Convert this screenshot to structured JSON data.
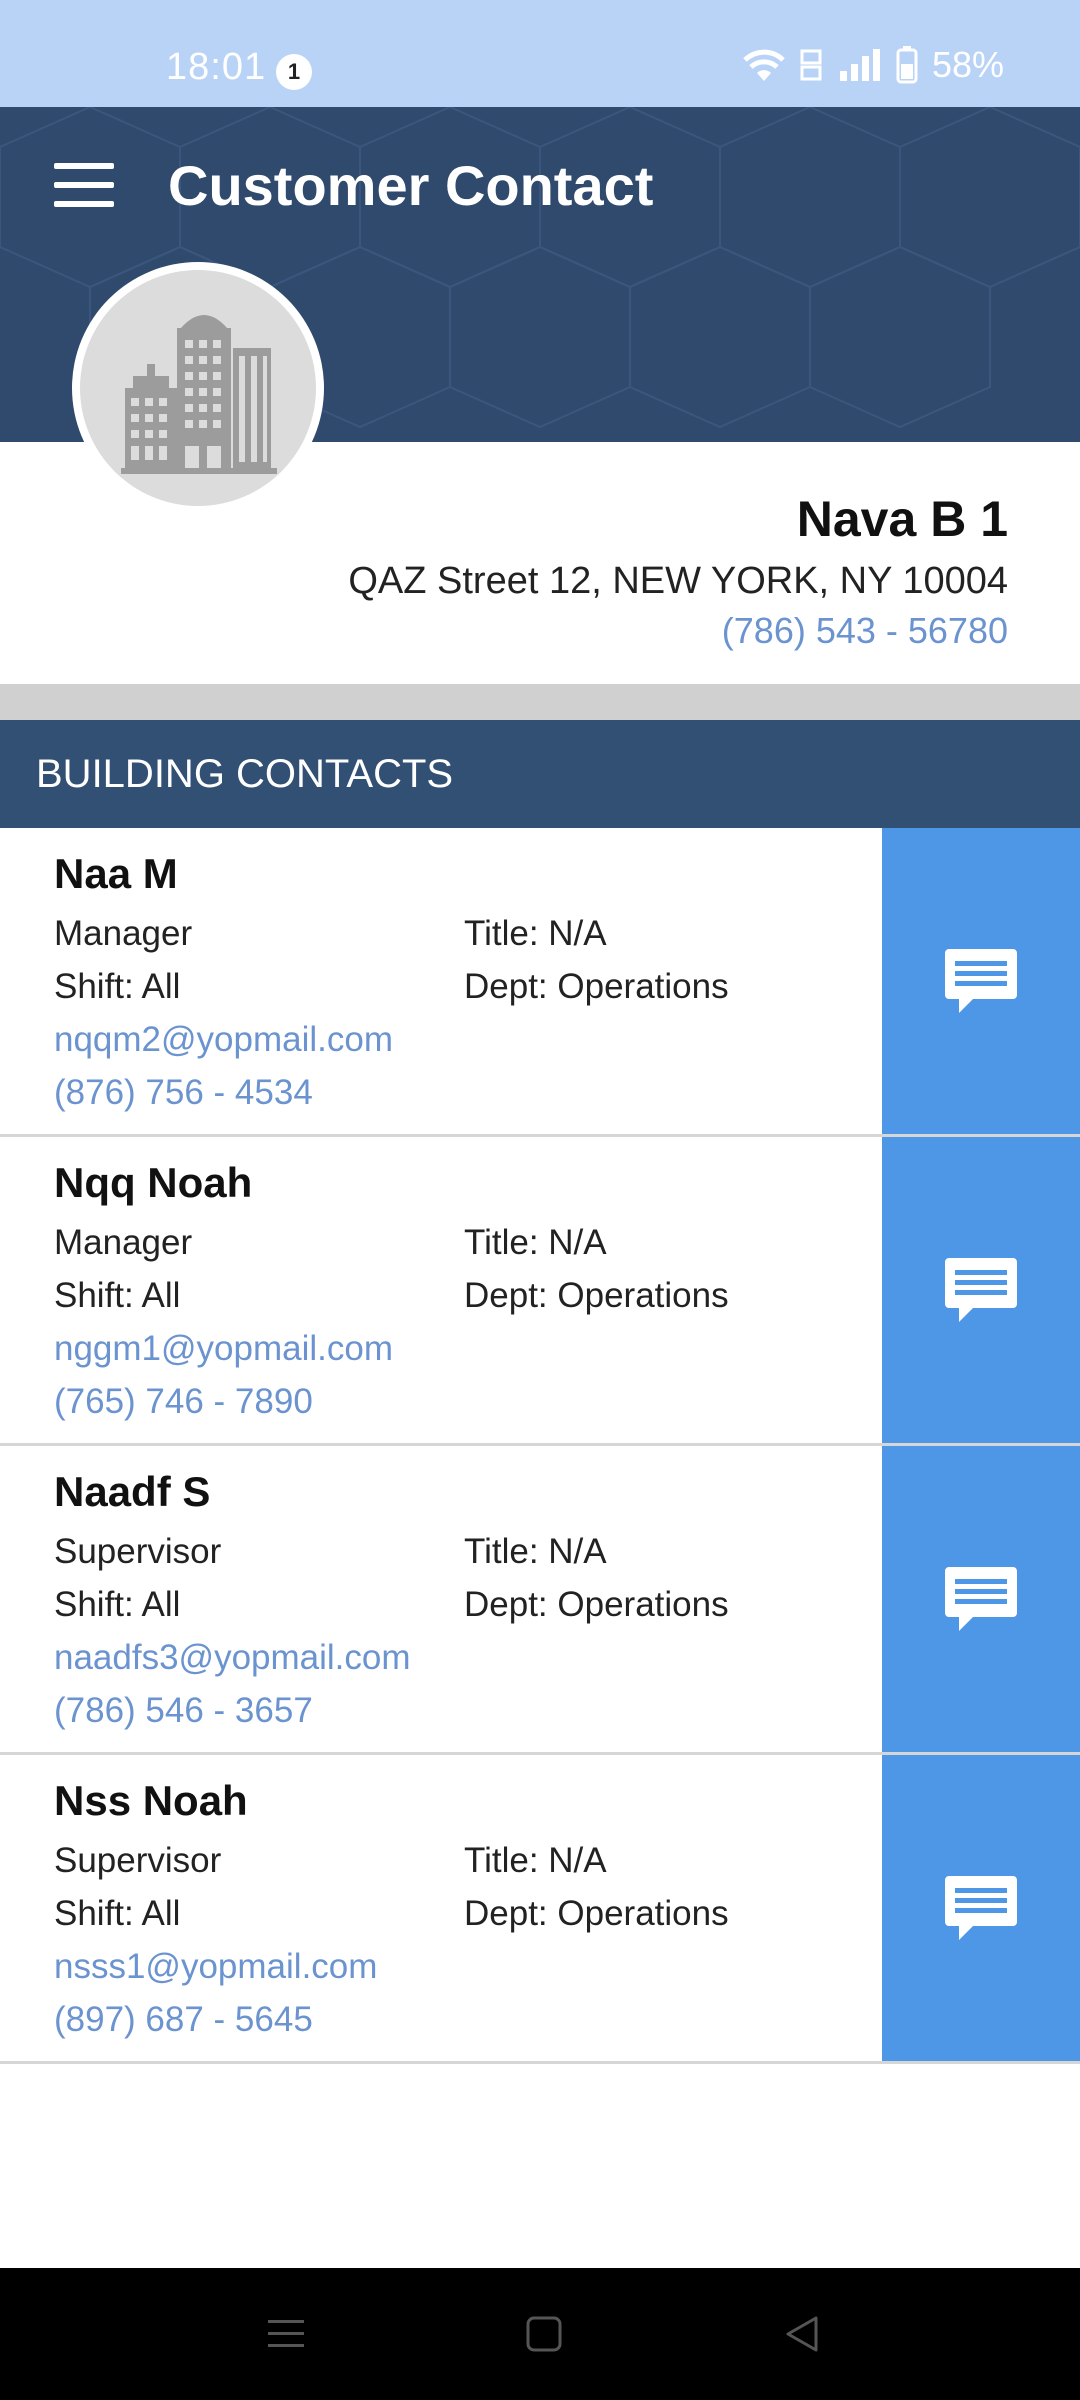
{
  "status_bar": {
    "time": "18:01",
    "notification_count": "1",
    "battery": "58%"
  },
  "header": {
    "title": "Customer Contact"
  },
  "building": {
    "name": "Nava B 1",
    "address": "QAZ Street 12, NEW YORK, NY 10004",
    "phone": "(786) 543 - 56780"
  },
  "section": {
    "title": "BUILDING CONTACTS"
  },
  "contacts": [
    {
      "name": "Naa M",
      "role": "Manager",
      "shift": "Shift: All",
      "email": "nqqm2@yopmail.com",
      "phone": "(876) 756 - 4534",
      "title": "Title: N/A",
      "dept": "Dept: Operations"
    },
    {
      "name": "Nqq Noah",
      "role": "Manager",
      "shift": "Shift: All",
      "email": "nggm1@yopmail.com",
      "phone": "(765) 746 - 7890",
      "title": "Title: N/A",
      "dept": "Dept: Operations"
    },
    {
      "name": "Naadf S",
      "role": "Supervisor",
      "shift": "Shift: All",
      "email": "naadfs3@yopmail.com",
      "phone": "(786) 546 - 3657",
      "title": "Title: N/A",
      "dept": "Dept: Operations"
    },
    {
      "name": "Nss Noah",
      "role": "Supervisor",
      "shift": "Shift: All",
      "email": "nsss1@yopmail.com",
      "phone": "(897) 687 - 5645",
      "title": "Title: N/A",
      "dept": "Dept: Operations"
    }
  ],
  "colors": {
    "status_bar": "#b9d3f7",
    "header": "#2f4a6d",
    "section_header": "#324f74",
    "message_button": "#4e97e6",
    "link": "#6a93cf"
  },
  "icons": {
    "menu": "hamburger-menu-icon",
    "avatar": "building-icon",
    "message": "chat-message-icon",
    "nav_recent": "recent-apps-icon",
    "nav_home": "home-icon",
    "nav_back": "back-icon"
  }
}
